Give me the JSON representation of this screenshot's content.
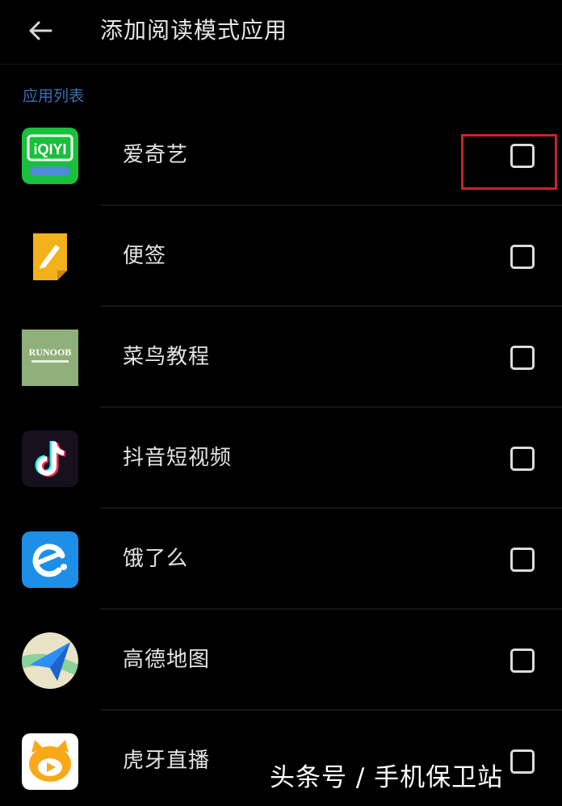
{
  "header": {
    "back_icon": "arrow-left-icon",
    "title": "添加阅读模式应用"
  },
  "section_label": "应用列表",
  "apps": [
    {
      "name": "爱奇艺",
      "icon": "iqiyi-app-icon",
      "icon_text": "iQIYI",
      "checked": false
    },
    {
      "name": "便签",
      "icon": "notes-app-icon",
      "checked": false
    },
    {
      "name": "菜鸟教程",
      "icon": "runoob-app-icon",
      "icon_text": "RUNOOB",
      "checked": false
    },
    {
      "name": "抖音短视频",
      "icon": "douyin-app-icon",
      "checked": false
    },
    {
      "name": "饿了么",
      "icon": "eleme-app-icon",
      "checked": false
    },
    {
      "name": "高德地图",
      "icon": "amap-app-icon",
      "checked": false
    },
    {
      "name": "虎牙直播",
      "icon": "huya-app-icon",
      "checked": false
    }
  ],
  "colors": {
    "background": "#000000",
    "section_label": "#3c6fb0",
    "highlight_border": "#c8242a"
  },
  "watermark": "头条号 / 手机保卫站"
}
